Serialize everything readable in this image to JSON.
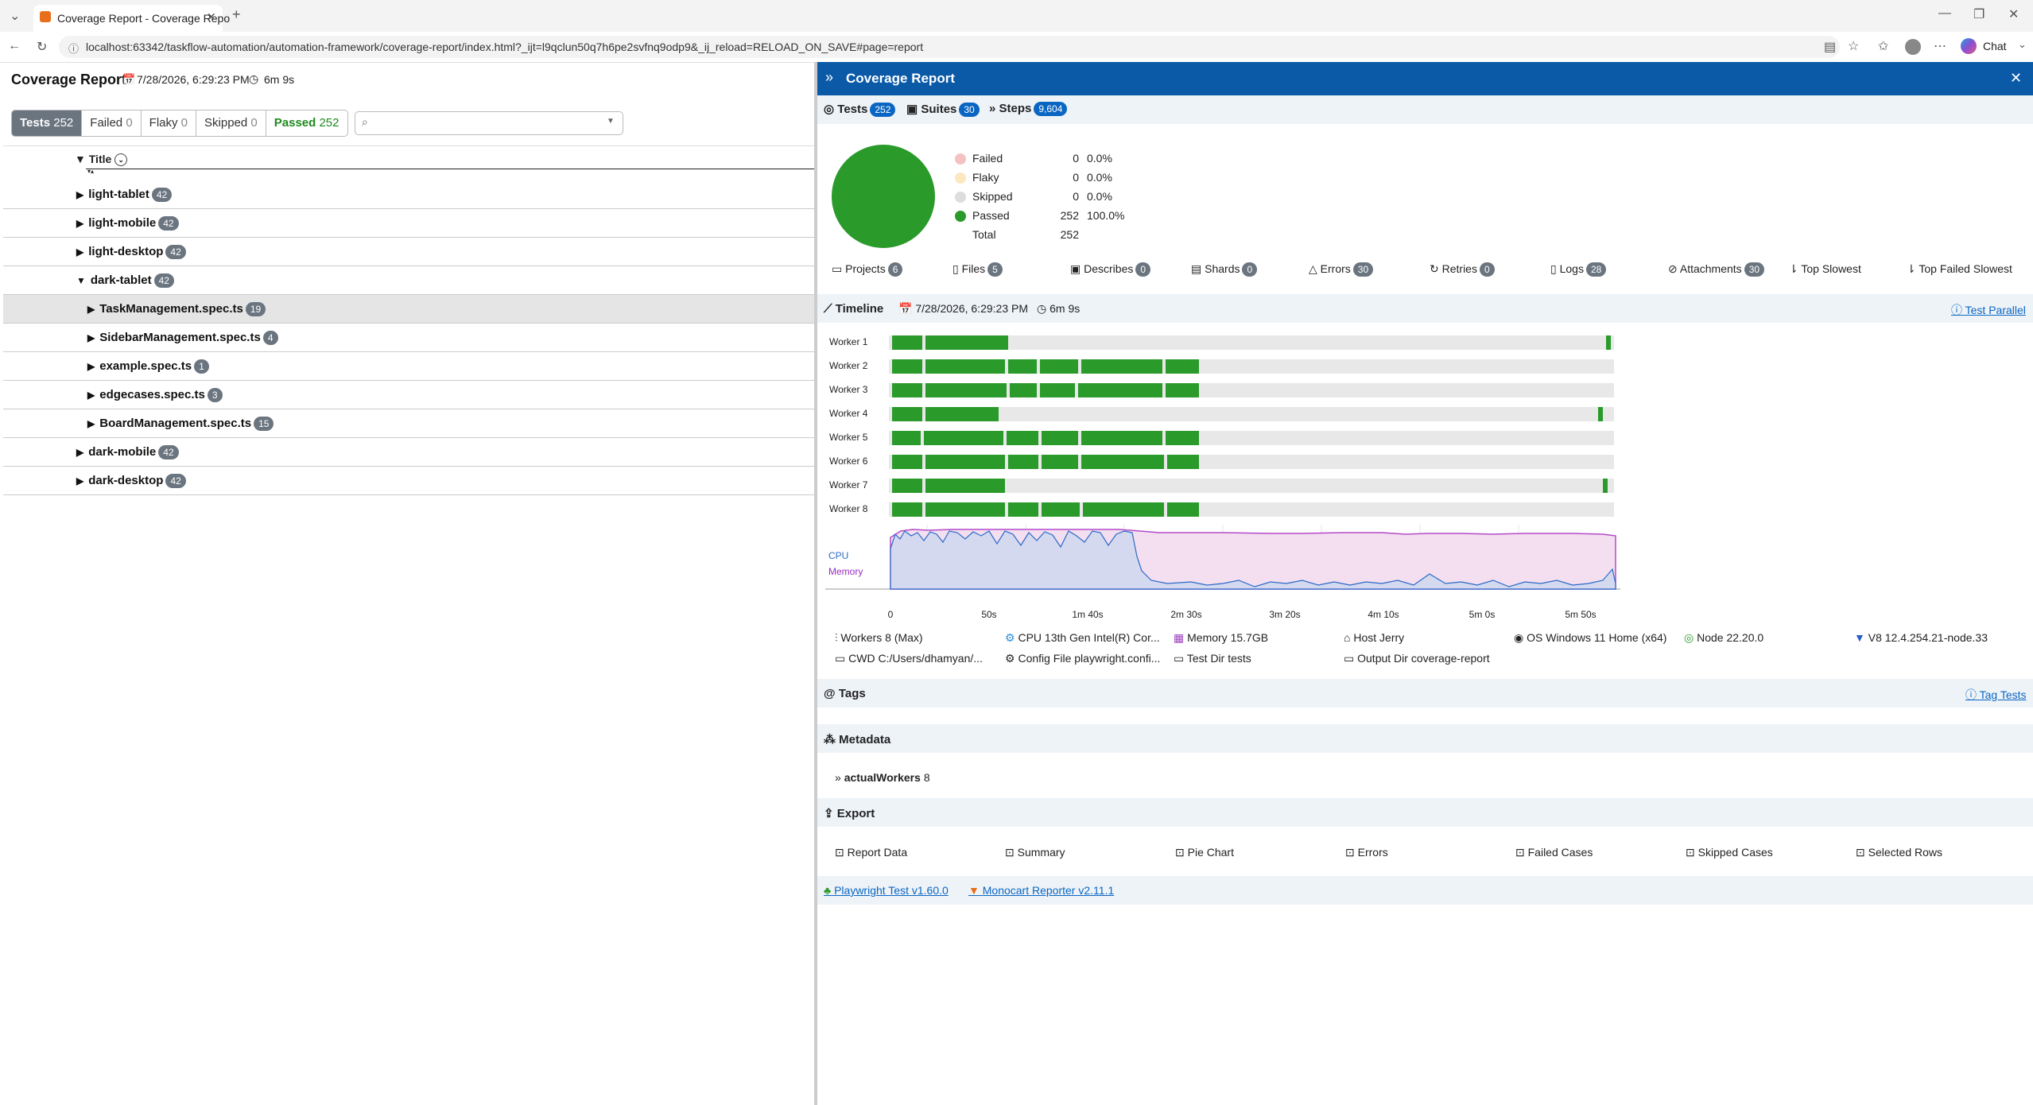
{
  "browser": {
    "tab_title": "Coverage Report - Coverage Repo",
    "url": "localhost:63342/taskflow-automation/automation-framework/coverage-report/index.html?_ijt=l9qclun50q7h6pe2svfnq9odp9&_ij_reload=RELOAD_ON_SAVE#page=report",
    "chat_label": "Chat"
  },
  "left": {
    "title": "Coverage Report",
    "date": "7/28/2026, 6:29:23 PM",
    "duration": "6m 9s",
    "filters": [
      {
        "label": "Tests",
        "count": "252"
      },
      {
        "label": "Failed",
        "count": "0"
      },
      {
        "label": "Flaky",
        "count": "0"
      },
      {
        "label": "Skipped",
        "count": "0"
      },
      {
        "label": "Passed",
        "count": "252"
      }
    ],
    "column_title": "Title",
    "rows": [
      {
        "label": "light-tablet",
        "count": "42"
      },
      {
        "label": "light-mobile",
        "count": "42"
      },
      {
        "label": "light-desktop",
        "count": "42"
      },
      {
        "label": "dark-tablet",
        "count": "42"
      },
      {
        "label": "TaskManagement.spec.ts",
        "count": "19"
      },
      {
        "label": "SidebarManagement.spec.ts",
        "count": "4"
      },
      {
        "label": "example.spec.ts",
        "count": "1"
      },
      {
        "label": "edgecases.spec.ts",
        "count": "3"
      },
      {
        "label": "BoardManagement.spec.ts",
        "count": "15"
      },
      {
        "label": "dark-mobile",
        "count": "42"
      },
      {
        "label": "dark-desktop",
        "count": "42"
      }
    ]
  },
  "right": {
    "title": "Coverage Report",
    "stat_tabs": [
      {
        "label": "Tests",
        "count": "252"
      },
      {
        "label": "Suites",
        "count": "30"
      },
      {
        "label": "Steps",
        "count": "9,604"
      }
    ],
    "legend": [
      {
        "name": "Failed",
        "n": "0",
        "pct": "0.0%",
        "color": "#f4c2c2"
      },
      {
        "name": "Flaky",
        "n": "0",
        "pct": "0.0%",
        "color": "#fce8c0"
      },
      {
        "name": "Skipped",
        "n": "0",
        "pct": "0.0%",
        "color": "#dddddd"
      },
      {
        "name": "Passed",
        "n": "252",
        "pct": "100.0%",
        "color": "#2a9a2a"
      },
      {
        "name": "Total",
        "n": "252",
        "pct": ""
      }
    ],
    "nav": [
      {
        "label": "Projects",
        "count": "6"
      },
      {
        "label": "Files",
        "count": "5"
      },
      {
        "label": "Describes",
        "count": "0"
      },
      {
        "label": "Shards",
        "count": "0"
      },
      {
        "label": "Errors",
        "count": "30"
      },
      {
        "label": "Retries",
        "count": "0"
      },
      {
        "label": "Logs",
        "count": "28"
      },
      {
        "label": "Attachments",
        "count": "30"
      },
      {
        "label": "Top Slowest",
        "count": ""
      },
      {
        "label": "Top Failed Slowest",
        "count": ""
      }
    ],
    "timeline": {
      "title": "Timeline",
      "date": "7/28/2026, 6:29:23 PM",
      "duration": "6m 9s",
      "link": "Test Parallel",
      "workers": [
        "Worker 1",
        "Worker 2",
        "Worker 3",
        "Worker 4",
        "Worker 5",
        "Worker 6",
        "Worker 7",
        "Worker 8"
      ],
      "cpu_label": "CPU",
      "memory_label": "Memory",
      "ticks": [
        "0",
        "50s",
        "1m 40s",
        "2m 30s",
        "3m 20s",
        "4m 10s",
        "5m 0s",
        "5m 50s"
      ]
    },
    "system": [
      "Workers 8 (Max)",
      "CPU 13th Gen Intel(R) Cor...",
      "Memory 15.7GB",
      "Host Jerry",
      "OS Windows 11 Home (x64)",
      "Node 22.20.0",
      "V8 12.4.254.21-node.33",
      "CWD C:/Users/dhamyan/...",
      "Config File playwright.confi...",
      "Test Dir tests",
      "Output Dir coverage-report"
    ],
    "tags": {
      "title": "Tags",
      "link": "Tag Tests"
    },
    "metadata": {
      "title": "Metadata",
      "key": "actualWorkers",
      "value": "8"
    },
    "export": {
      "title": "Export",
      "items": [
        "Report Data",
        "Summary",
        "Pie Chart",
        "Errors",
        "Failed Cases",
        "Skipped Cases",
        "Selected Rows"
      ]
    },
    "footer": {
      "link1": "Playwright Test v1.60.0",
      "link2": "Monocart Reporter v2.11.1"
    }
  }
}
